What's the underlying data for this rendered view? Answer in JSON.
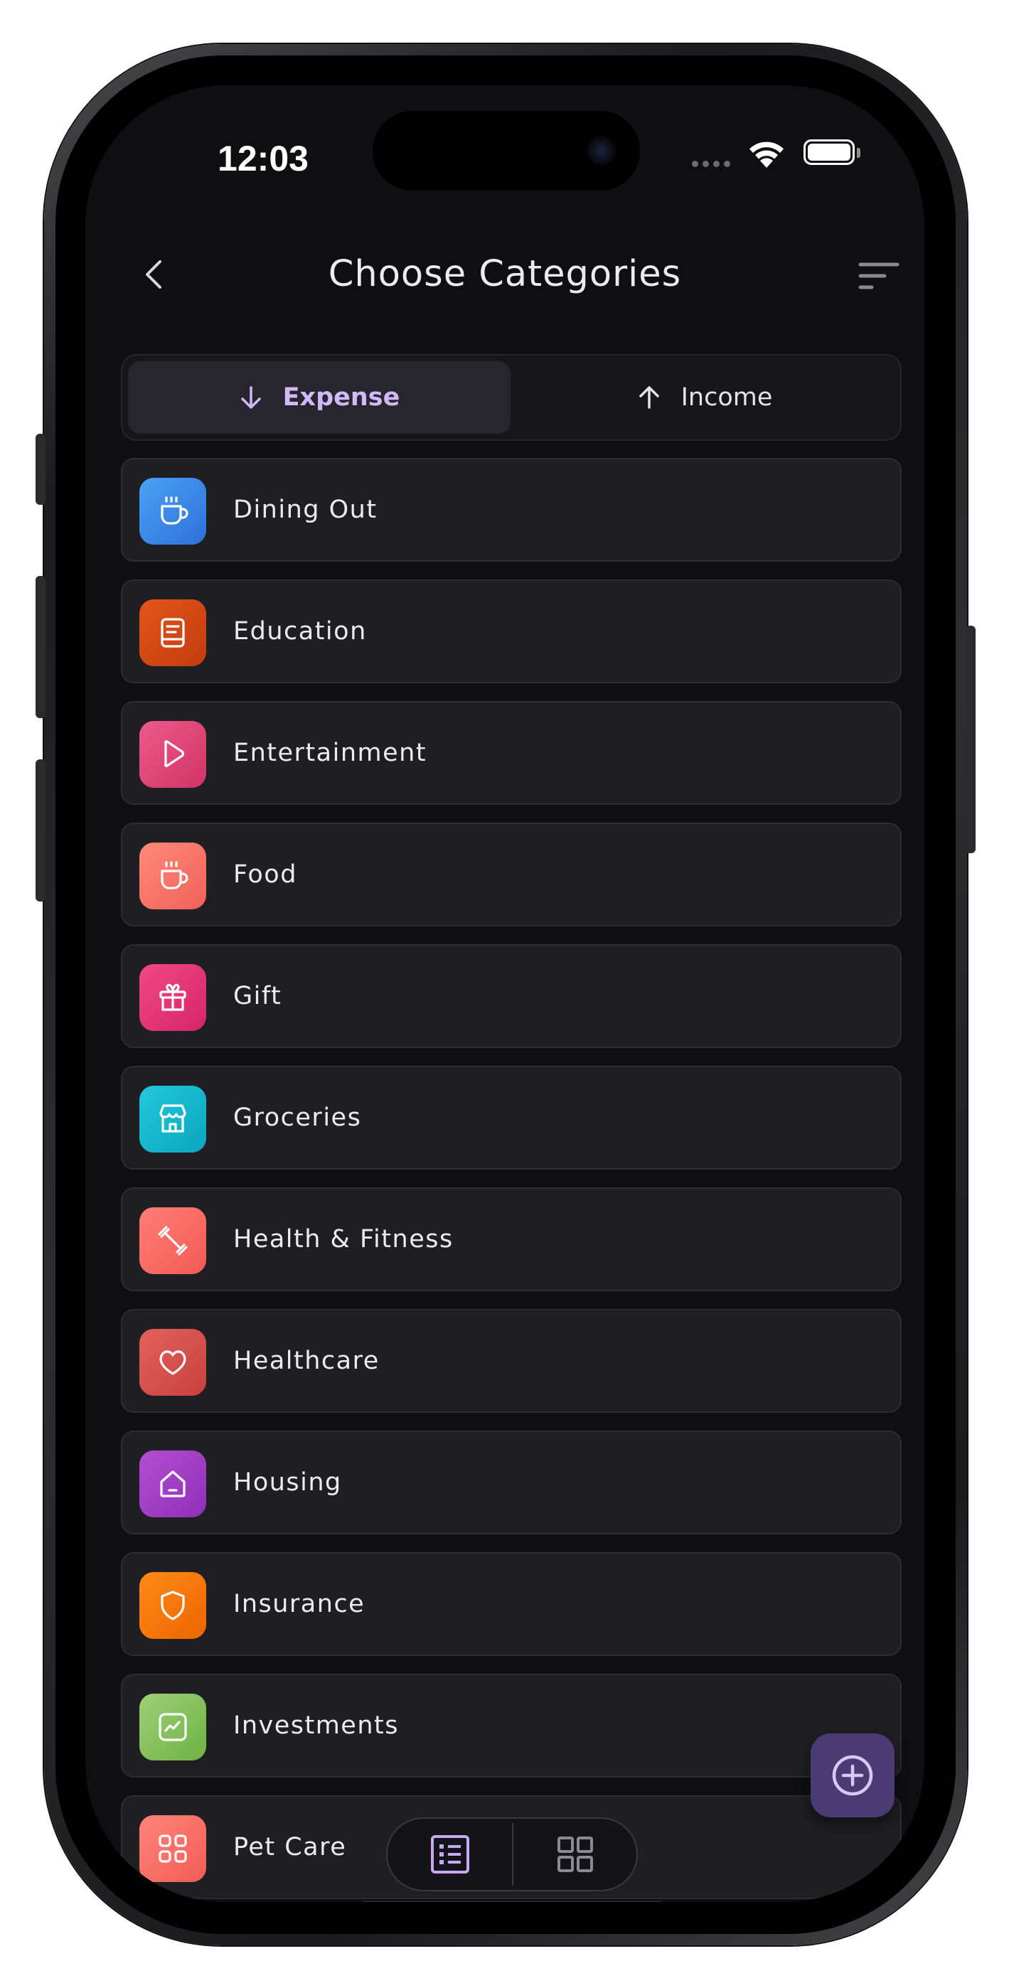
{
  "status_bar": {
    "time": "12:03"
  },
  "header": {
    "title": "Choose Categories"
  },
  "tabs": [
    {
      "label": "Expense",
      "active": true
    },
    {
      "label": "Income",
      "active": false
    }
  ],
  "categories": [
    {
      "label": "Dining Out",
      "icon": "cup-icon",
      "color_from": "#4aa3f5",
      "color_to": "#2f6fd8"
    },
    {
      "label": "Education",
      "icon": "book-icon",
      "color_from": "#e4551b",
      "color_to": "#c23c0f"
    },
    {
      "label": "Entertainment",
      "icon": "play-icon",
      "color_from": "#ec5a8a",
      "color_to": "#d03467"
    },
    {
      "label": "Food",
      "icon": "cup-icon",
      "color_from": "#ff8a78",
      "color_to": "#f0605a"
    },
    {
      "label": "Gift",
      "icon": "gift-icon",
      "color_from": "#f04a85",
      "color_to": "#d62467"
    },
    {
      "label": "Groceries",
      "icon": "store-icon",
      "color_from": "#22c9d9",
      "color_to": "#0aa6bf"
    },
    {
      "label": "Health & Fitness",
      "icon": "dumbbell-icon",
      "color_from": "#ff7e76",
      "color_to": "#f25a55"
    },
    {
      "label": "Healthcare",
      "icon": "heart-icon",
      "color_from": "#e2625e",
      "color_to": "#c7413c"
    },
    {
      "label": "Housing",
      "icon": "house-icon",
      "color_from": "#b34fd0",
      "color_to": "#8f2fb8"
    },
    {
      "label": "Insurance",
      "icon": "shield-icon",
      "color_from": "#ff8a1a",
      "color_to": "#ec6500"
    },
    {
      "label": "Investments",
      "icon": "chart-icon",
      "color_from": "#9fd076",
      "color_to": "#6fb244"
    },
    {
      "label": "Pet Care",
      "icon": "grid-icon",
      "color_from": "#ff857a",
      "color_to": "#f25c56"
    }
  ],
  "colors": {
    "accent": "#d2b8f7",
    "fab": "#4b3a73",
    "screen_bg": "#0f0e11",
    "row_bg": "#1f1e23"
  },
  "bottom_switcher": {
    "list_icon": "list-view-icon",
    "grid_icon": "grid-view-icon",
    "active": "list"
  }
}
